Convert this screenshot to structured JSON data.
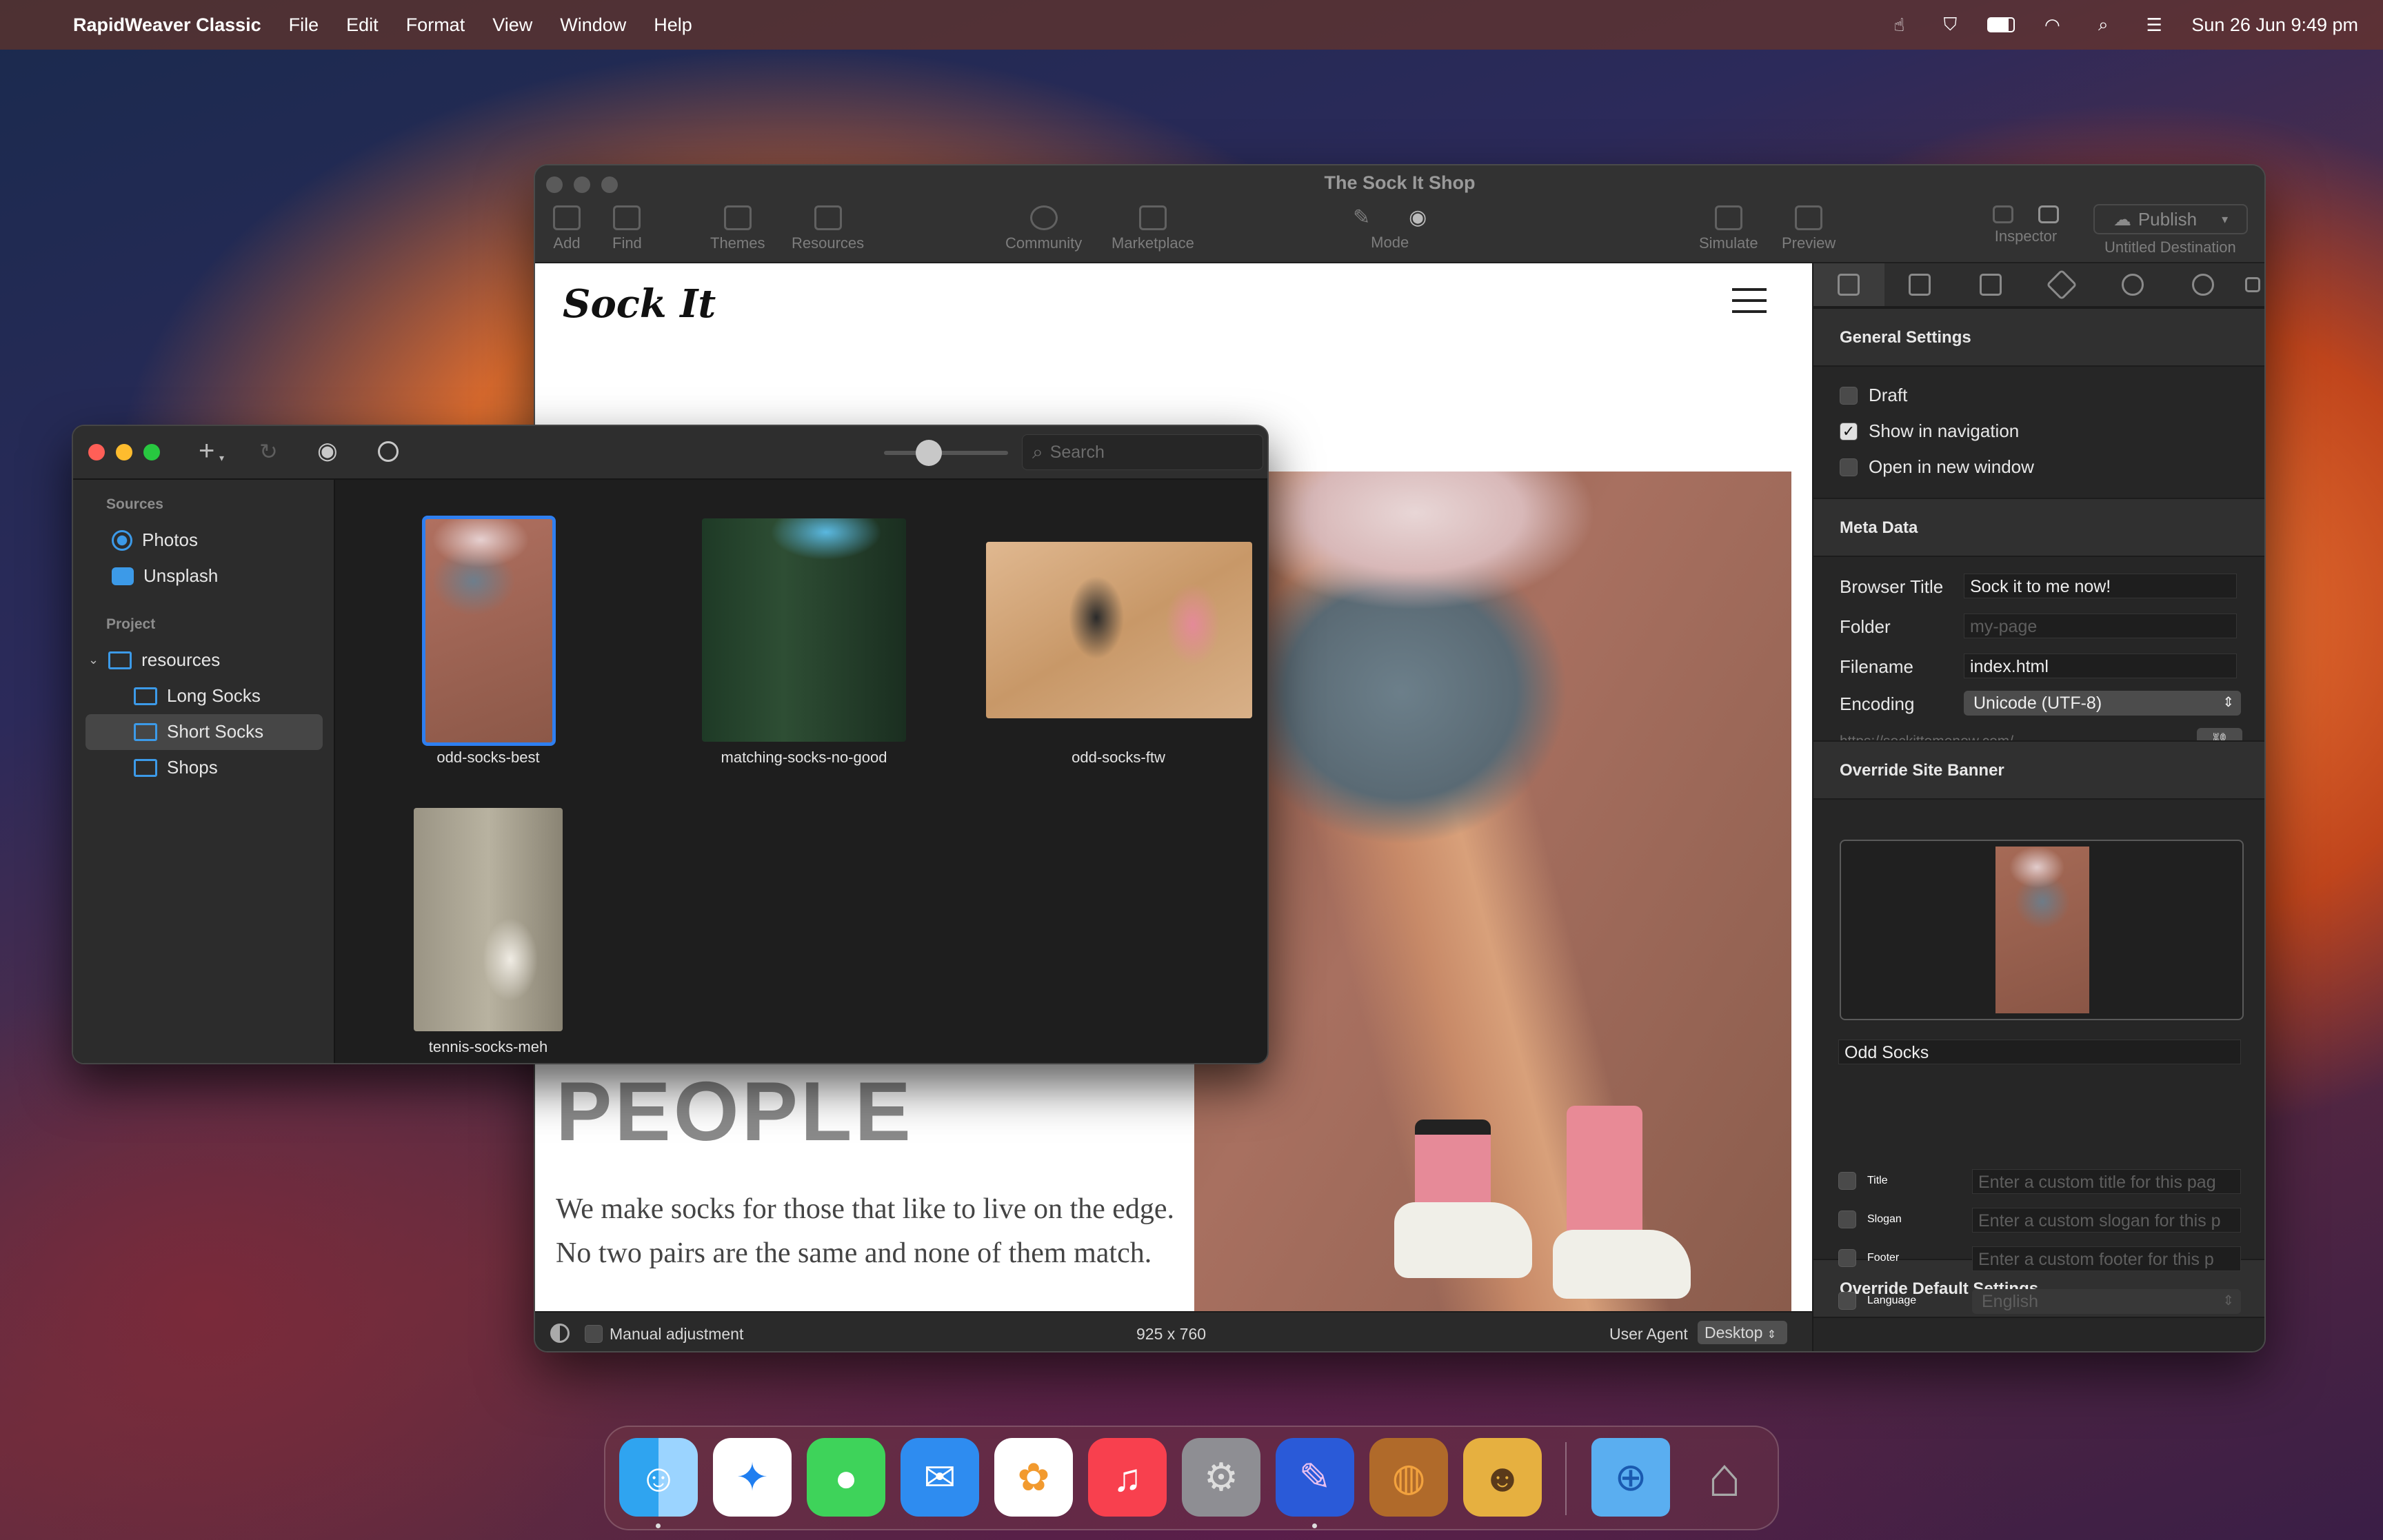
{
  "menubar": {
    "app": "RapidWeaver Classic",
    "menus": [
      "File",
      "Edit",
      "Format",
      "View",
      "Window",
      "Help"
    ],
    "clock": "Sun 26 Jun  9:49 pm"
  },
  "main_window": {
    "title": "The Sock It Shop",
    "toolbar": {
      "add": "Add",
      "find": "Find",
      "themes": "Themes",
      "resources": "Resources",
      "community": "Community",
      "marketplace": "Marketplace",
      "mode": "Mode",
      "simulate": "Simulate",
      "preview": "Preview",
      "inspector": "Inspector",
      "publish": "Publish",
      "destination": "Untitled Destination"
    },
    "site": {
      "logo": "Sock It",
      "heading_fragment": "PEOPLE",
      "paragraph": "We make socks for those that like to live on the edge. No two pairs are the same and none of them match."
    },
    "status": {
      "manual_adjustment": "Manual adjustment",
      "dimensions": "925 x 760",
      "user_agent_label": "User Agent",
      "user_agent_value": "Desktop"
    }
  },
  "inspector": {
    "general": {
      "title": "General Settings",
      "draft": "Draft",
      "show_in_nav": "Show in navigation",
      "open_new_window": "Open in new window"
    },
    "meta": {
      "title": "Meta Data",
      "browser_title_label": "Browser Title",
      "browser_title_value": "Sock it to me now!",
      "folder_label": "Folder",
      "folder_placeholder": "my-page",
      "filename_label": "Filename",
      "filename_value": "index.html",
      "encoding_label": "Encoding",
      "encoding_value": "Unicode (UTF-8)",
      "url": "https://sockittomenow.com/"
    },
    "banner": {
      "title": "Override Site Banner",
      "caption": "Odd Socks"
    },
    "defaults": {
      "title": "Override Default Settings",
      "title_label": "Title",
      "title_placeholder": "Enter a custom title for this pag",
      "slogan_label": "Slogan",
      "slogan_placeholder": "Enter a custom slogan for this p",
      "footer_label": "Footer",
      "footer_placeholder": "Enter a custom footer for this p",
      "language_label": "Language",
      "language_value": "English"
    }
  },
  "resource_browser": {
    "search_placeholder": "Search",
    "sources_header": "Sources",
    "sources": [
      "Photos",
      "Unsplash"
    ],
    "project_header": "Project",
    "root_folder": "resources",
    "folders": [
      "Long Socks",
      "Short Socks",
      "Shops"
    ],
    "selected_folder": "Short Socks",
    "images": [
      "odd-socks-best",
      "matching-socks-no-good",
      "odd-socks-ftw",
      "tennis-socks-meh"
    ]
  },
  "colors": {
    "accent": "#3c9ae8",
    "close": "#ff5f57",
    "minimize": "#febc2e",
    "zoom": "#28c840"
  }
}
